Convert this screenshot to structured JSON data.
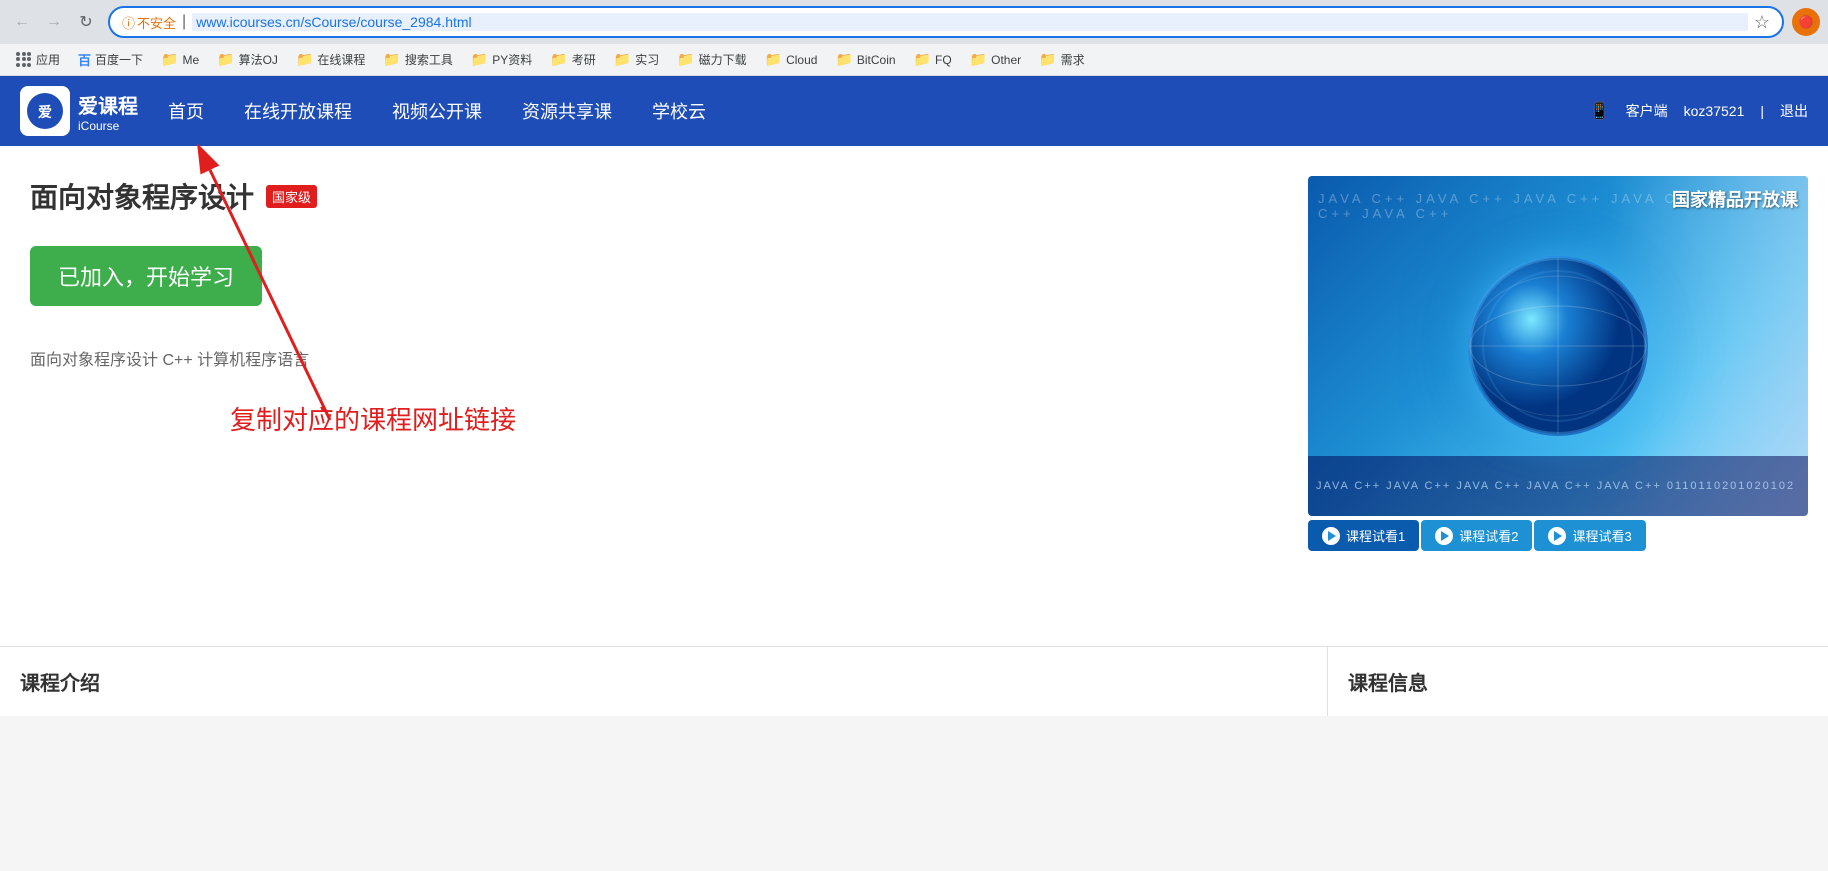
{
  "browser": {
    "back_disabled": true,
    "forward_disabled": true,
    "security_label": "不安全",
    "url": "www.icourses.cn/sCourse/course_2984.html",
    "star_label": "☆",
    "apps_label": "应用"
  },
  "bookmarks": [
    {
      "label": "应用",
      "type": "apps"
    },
    {
      "label": "百度一下",
      "type": "link"
    },
    {
      "label": "Me",
      "type": "folder"
    },
    {
      "label": "算法OJ",
      "type": "folder"
    },
    {
      "label": "在线课程",
      "type": "folder"
    },
    {
      "label": "搜索工具",
      "type": "folder"
    },
    {
      "label": "PY资料",
      "type": "folder"
    },
    {
      "label": "考研",
      "type": "folder"
    },
    {
      "label": "实习",
      "type": "folder"
    },
    {
      "label": "磁力下载",
      "type": "folder"
    },
    {
      "label": "Cloud",
      "type": "folder"
    },
    {
      "label": "BitCoin",
      "type": "folder"
    },
    {
      "label": "FQ",
      "type": "folder"
    },
    {
      "label": "Other",
      "type": "folder"
    },
    {
      "label": "需求",
      "type": "folder"
    }
  ],
  "nav": {
    "logo_cn": "爱课程",
    "logo_en": "iCourse",
    "links": [
      "首页",
      "在线开放课程",
      "视频公开课",
      "资源共享课",
      "学校云"
    ],
    "right": {
      "mobile": "客户端",
      "user": "koz37521",
      "logout": "退出"
    }
  },
  "course": {
    "title": "面向对象程序设计",
    "badge": "国家级",
    "start_button": "已加入，开始学习",
    "description": "面向对象程序设计 C++ 计算机程序语言",
    "image_overlay": "国家精品开放课",
    "annotation": "复制对应的课程网址链接",
    "previews": [
      "课程试看1",
      "课程试看2",
      "课程试看3"
    ],
    "code_bg_text": "JAVA C++ JAVA C++ JAVA C++ JAVA C++ JAVA C++ 0110110201020102"
  },
  "sections": {
    "intro_title": "课程介绍",
    "info_title": "课程信息"
  }
}
